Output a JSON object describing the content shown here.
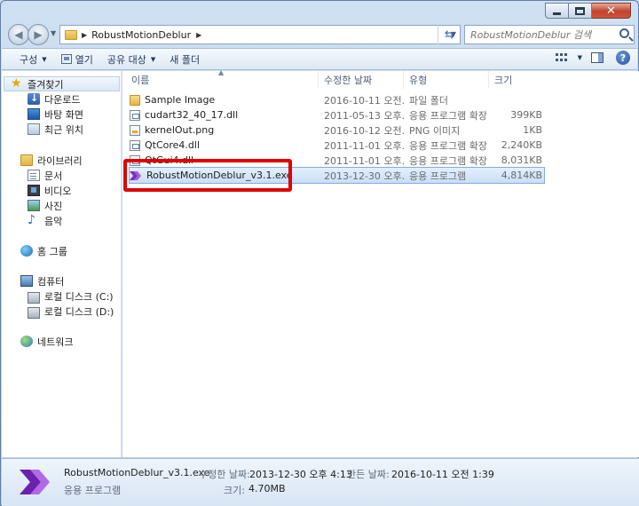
{
  "window": {
    "close_glyph": "✕"
  },
  "address": {
    "path": "RobustMotionDeblur",
    "search_placeholder": "RobustMotionDeblur 검색"
  },
  "toolbar": {
    "organize": "구성",
    "open": "열기",
    "share": "공유 대상",
    "new_folder": "새 폴더",
    "help": "?"
  },
  "sidebar": {
    "favorites": {
      "label": "즐겨찾기",
      "items": [
        "다운로드",
        "바탕 화면",
        "최근 위치"
      ]
    },
    "libraries": {
      "label": "라이브러리",
      "items": [
        "문서",
        "비디오",
        "사진",
        "음악"
      ]
    },
    "homegroup": "홈 그룹",
    "computer": {
      "label": "컴퓨터",
      "items": [
        "로컬 디스크 (C:)",
        "로컬 디스크 (D:)"
      ]
    },
    "network": "네트워크"
  },
  "columns": {
    "name": "이름",
    "date": "수정한 날짜",
    "type": "유형",
    "size": "크기"
  },
  "files": [
    {
      "name": "Sample Image",
      "date": "2016-10-11 오전...",
      "type": "파일 폴더",
      "size": ""
    },
    {
      "name": "cudart32_40_17.dll",
      "date": "2011-05-13 오후...",
      "type": "응용 프로그램 확장",
      "size": "399KB"
    },
    {
      "name": "kernelOut.png",
      "date": "2016-10-12 오전...",
      "type": "PNG 이미지",
      "size": "1KB"
    },
    {
      "name": "QtCore4.dll",
      "date": "2011-11-01 오후...",
      "type": "응용 프로그램 확장",
      "size": "2,240KB"
    },
    {
      "name": "QtGui4.dll",
      "date": "2011-11-01 오후...",
      "type": "응용 프로그램 확장",
      "size": "8,031KB"
    },
    {
      "name": "RobustMotionDeblur_v3.1.exe",
      "date": "2013-12-30 오후...",
      "type": "응용 프로그램",
      "size": "4,814KB"
    }
  ],
  "details": {
    "name": "RobustMotionDeblur_v3.1.exe",
    "type": "응용 프로그램",
    "modified_label": "수정한 날짜:",
    "modified_value": "2013-12-30 오후 4:13",
    "created_label": "만든 날짜:",
    "created_value": "2016-10-11 오전 1:39",
    "size_label": "크기:",
    "size_value": "4.70MB"
  },
  "colors": {
    "highlight_box": "#e00000",
    "exe_purple": "#7b2fbe"
  }
}
